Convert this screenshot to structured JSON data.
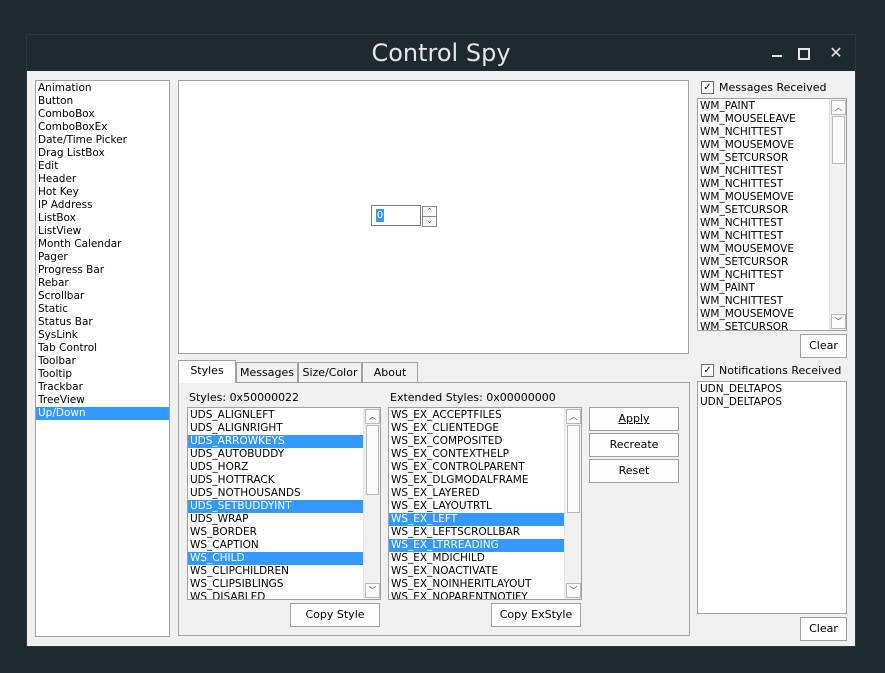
{
  "window": {
    "title": "Control Spy",
    "min_glyph": "",
    "close_glyph": "✕"
  },
  "controls_list": {
    "items": [
      "Animation",
      "Button",
      "ComboBox",
      "ComboBoxEx",
      "Date/Time Picker",
      "Drag ListBox",
      "Edit",
      "Header",
      "Hot Key",
      "IP Address",
      "ListBox",
      "ListView",
      "Month Calendar",
      "Pager",
      "Progress Bar",
      "Rebar",
      "Scrollbar",
      "Static",
      "Status Bar",
      "SysLink",
      "Tab Control",
      "Toolbar",
      "Tooltip",
      "Trackbar",
      "TreeView",
      "Up/Down"
    ],
    "selected": "Up/Down"
  },
  "preview": {
    "edit_value": "0",
    "up_arrow": "⌃",
    "down_arrow": "⌄"
  },
  "tabs": [
    {
      "label": "Styles",
      "active": true
    },
    {
      "label": "Messages",
      "active": false
    },
    {
      "label": "Size/Color",
      "active": false
    },
    {
      "label": "About",
      "active": false
    }
  ],
  "styles": {
    "label": "Styles: 0x50000022",
    "items": [
      "UDS_ALIGNLEFT",
      "UDS_ALIGNRIGHT",
      "UDS_ARROWKEYS",
      "UDS_AUTOBUDDY",
      "UDS_HORZ",
      "UDS_HOTTRACK",
      "UDS_NOTHOUSANDS",
      "UDS_SETBUDDYINT",
      "UDS_WRAP",
      "WS_BORDER",
      "WS_CAPTION",
      "WS_CHILD",
      "WS_CLIPCHILDREN",
      "WS_CLIPSIBLINGS",
      "WS_DISABLED"
    ],
    "selected": [
      "UDS_ARROWKEYS",
      "UDS_SETBUDDYINT",
      "WS_CHILD"
    ],
    "copy_button": "Copy Style"
  },
  "ex_styles": {
    "label": "Extended Styles: 0x00000000",
    "items": [
      "WS_EX_ACCEPTFILES",
      "WS_EX_CLIENTEDGE",
      "WS_EX_COMPOSITED",
      "WS_EX_CONTEXTHELP",
      "WS_EX_CONTROLPARENT",
      "WS_EX_DLGMODALFRAME",
      "WS_EX_LAYERED",
      "WS_EX_LAYOUTRTL",
      "WS_EX_LEFT",
      "WS_EX_LEFTSCROLLBAR",
      "WS_EX_LTRREADING",
      "WS_EX_MDICHILD",
      "WS_EX_NOACTIVATE",
      "WS_EX_NOINHERITLAYOUT",
      "WS_EX_NOPARENTNOTIFY"
    ],
    "selected": [
      "WS_EX_LEFT",
      "WS_EX_LTRREADING"
    ],
    "copy_button": "Copy ExStyle"
  },
  "actions": {
    "apply": "Apply",
    "recreate": "Recreate",
    "reset": "Reset"
  },
  "messages": {
    "label": "Messages Received",
    "checked": true,
    "items": [
      "WM_PAINT",
      "WM_MOUSELEAVE",
      "WM_NCHITTEST",
      "WM_MOUSEMOVE",
      "WM_SETCURSOR",
      "WM_NCHITTEST",
      "WM_NCHITTEST",
      "WM_MOUSEMOVE",
      "WM_SETCURSOR",
      "WM_NCHITTEST",
      "WM_NCHITTEST",
      "WM_MOUSEMOVE",
      "WM_SETCURSOR",
      "WM_NCHITTEST",
      "WM_PAINT",
      "WM_NCHITTEST",
      "WM_MOUSEMOVE",
      "WM_SETCURSOR"
    ],
    "clear_button": "Clear"
  },
  "notifications": {
    "label": "Notifications Received",
    "checked": true,
    "items": [
      "UDN_DELTAPOS",
      "UDN_DELTAPOS"
    ],
    "clear_button": "Clear"
  },
  "glyphs": {
    "check": "✓",
    "scroll_up": "︿",
    "scroll_down": "﹀"
  }
}
